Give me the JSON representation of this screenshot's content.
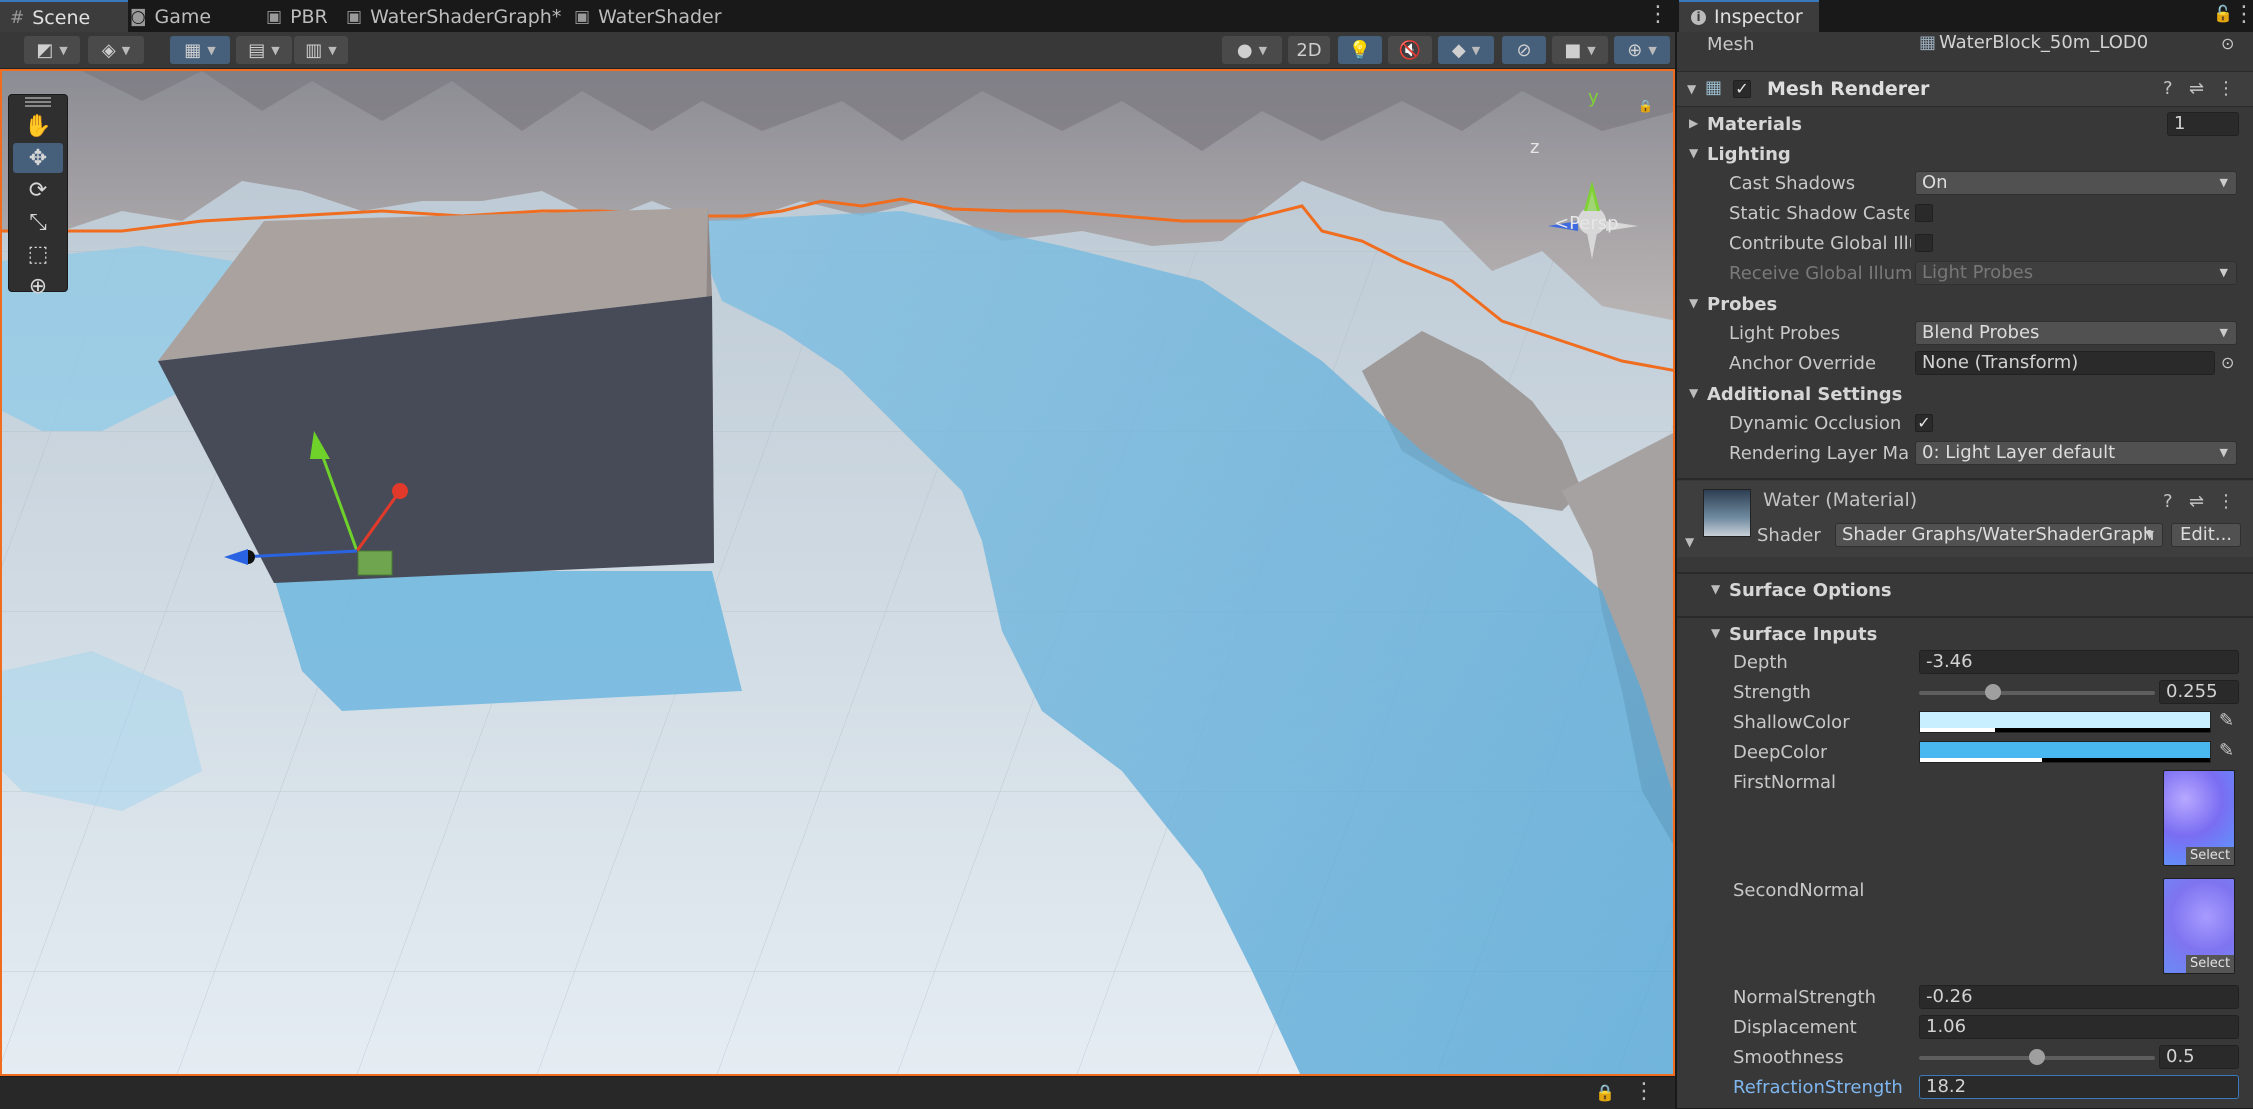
{
  "tabs": [
    {
      "label": "Scene",
      "icon": "grid-icon"
    },
    {
      "label": "Game",
      "icon": "gamepad-icon"
    },
    {
      "label": "PBR",
      "icon": "shadergraph-icon"
    },
    {
      "label": "WaterShaderGraph*",
      "icon": "shadergraph-icon"
    },
    {
      "label": "WaterShader",
      "icon": "shadergraph-icon"
    }
  ],
  "toolbar": {
    "mode_2d": "2D"
  },
  "viewport": {
    "persp_label": "<Persp",
    "gizmo_axes": {
      "y": "y",
      "z": "z"
    }
  },
  "inspector": {
    "tab_label": "Inspector",
    "mesh_label": "Mesh",
    "mesh_value": "WaterBlock_50m_LOD0",
    "mesh_renderer": {
      "title": "Mesh Renderer",
      "materials_label": "Materials",
      "materials_count": "1",
      "lighting_label": "Lighting",
      "cast_shadows_label": "Cast Shadows",
      "cast_shadows_value": "On",
      "static_shadow_label": "Static Shadow Caste",
      "contribute_gi_label": "Contribute Global Illu",
      "receive_gi_label": "Receive Global Illum",
      "receive_gi_value": "Light Probes",
      "probes_label": "Probes",
      "light_probes_label": "Light Probes",
      "light_probes_value": "Blend Probes",
      "anchor_override_label": "Anchor Override",
      "anchor_override_value": "None (Transform)",
      "additional_label": "Additional Settings",
      "dynamic_occlusion_label": "Dynamic Occlusion",
      "rendering_layer_label": "Rendering Layer Ma",
      "rendering_layer_value": "0: Light Layer default"
    },
    "material": {
      "title": "Water (Material)",
      "shader_label": "Shader",
      "shader_value": "Shader Graphs/WaterShaderGraph",
      "edit_label": "Edit...",
      "surface_options": "Surface Options",
      "surface_inputs": "Surface Inputs",
      "depth_label": "Depth",
      "depth_value": "-3.46",
      "strength_label": "Strength",
      "strength_value": "0.255",
      "strength_fraction": 0.3,
      "shallow_label": "ShallowColor",
      "shallow_color": "#c8efff",
      "shallow_alpha": 0.26,
      "deep_label": "DeepColor",
      "deep_color": "#4ab8f0",
      "deep_alpha": 0.42,
      "first_normal_label": "FirstNormal",
      "second_normal_label": "SecondNormal",
      "select_label": "Select",
      "normal_strength_label": "NormalStrength",
      "normal_strength_value": "-0.26",
      "displacement_label": "Displacement",
      "displacement_value": "1.06",
      "smoothness_label": "Smoothness",
      "smoothness_value": "0.5",
      "smoothness_fraction": 0.5,
      "refraction_label": "RefractionStrength",
      "refraction_value": "18.2"
    }
  },
  "colors": {
    "accent": "#3a79bb",
    "selection_outline": "#f06d1f",
    "water": "#7ec3e6"
  }
}
